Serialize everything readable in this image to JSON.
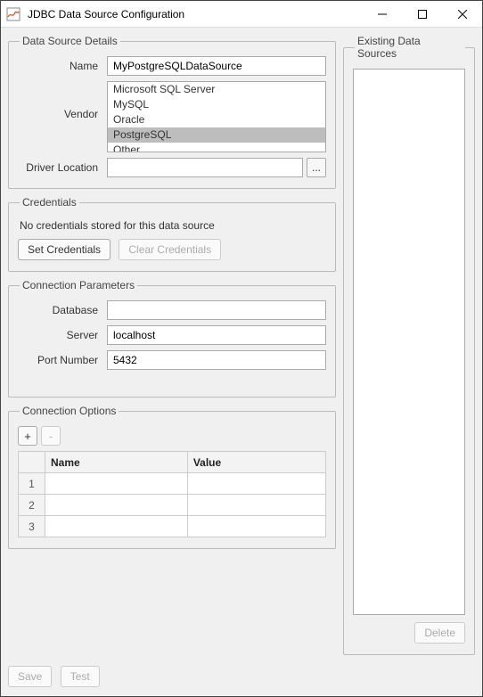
{
  "window": {
    "title": "JDBC Data Source Configuration"
  },
  "dataSourceDetails": {
    "legend": "Data Source Details",
    "nameLabel": "Name",
    "nameValue": "MyPostgreSQLDataSource",
    "vendorLabel": "Vendor",
    "vendors": {
      "item0": "Microsoft SQL Server",
      "item1": "MySQL",
      "item2": "Oracle",
      "item3": "PostgreSQL",
      "item4": "Other"
    },
    "driverLabel": "Driver Location",
    "driverValue": "",
    "browseLabel": "..."
  },
  "credentials": {
    "legend": "Credentials",
    "message": "No credentials stored for this data source",
    "setLabel": "Set Credentials",
    "clearLabel": "Clear Credentials"
  },
  "connectionParams": {
    "legend": "Connection Parameters",
    "databaseLabel": "Database",
    "databaseValue": "",
    "serverLabel": "Server",
    "serverValue": "localhost",
    "portLabel": "Port Number",
    "portValue": "5432"
  },
  "connectionOptions": {
    "legend": "Connection Options",
    "addLabel": "+",
    "removeLabel": "-",
    "colName": "Name",
    "colValue": "Value",
    "rows": {
      "r1": "1",
      "r2": "2",
      "r3": "3"
    }
  },
  "existing": {
    "legend": "Existing Data Sources",
    "deleteLabel": "Delete"
  },
  "footer": {
    "saveLabel": "Save",
    "testLabel": "Test"
  }
}
